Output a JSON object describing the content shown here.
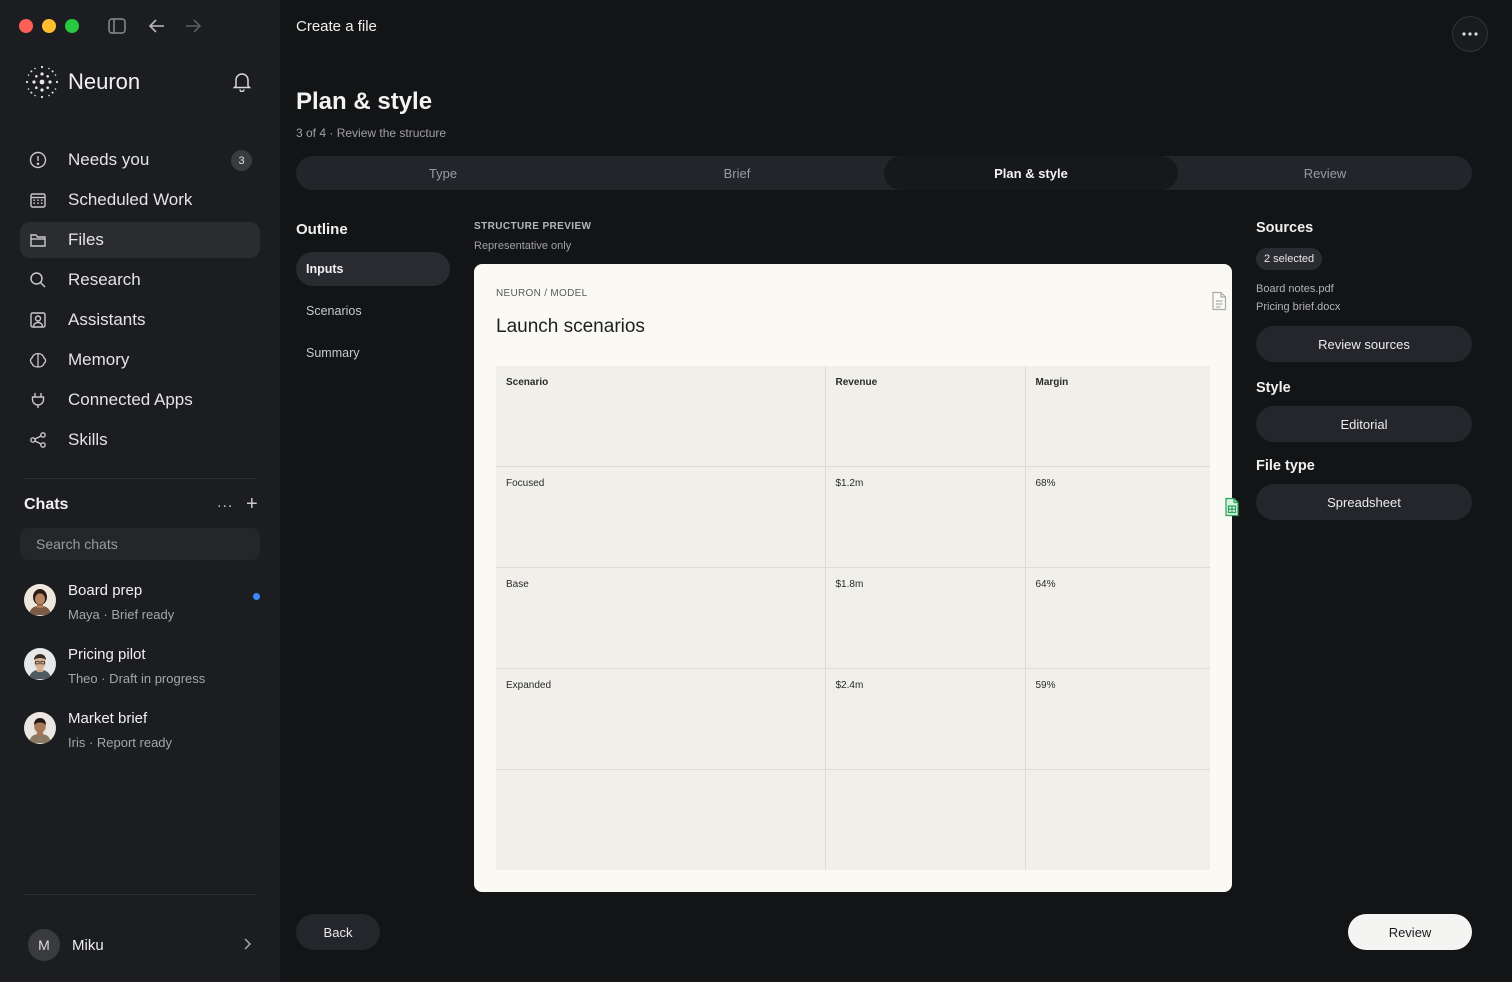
{
  "colors": {
    "close": "#ff5f57",
    "minimize": "#febc2e",
    "maximize": "#28c840",
    "unread": "#3b8bff",
    "sheet": "#2aa05a"
  },
  "app": {
    "name": "Neuron"
  },
  "nav": [
    {
      "label": "Needs you",
      "icon": "alert-circle-icon",
      "badge": "3"
    },
    {
      "label": "Scheduled Work",
      "icon": "calendar-icon"
    },
    {
      "label": "Files",
      "icon": "folder-icon",
      "active": true
    },
    {
      "label": "Research",
      "icon": "search-icon"
    },
    {
      "label": "Assistants",
      "icon": "assistant-icon"
    },
    {
      "label": "Memory",
      "icon": "brain-icon"
    },
    {
      "label": "Connected Apps",
      "icon": "plug-icon"
    },
    {
      "label": "Skills",
      "icon": "share-nodes-icon"
    }
  ],
  "chats": {
    "title": "Chats",
    "more": "...",
    "add": "+",
    "search_placeholder": "Search chats",
    "items": [
      {
        "title": "Board prep",
        "subtitle": "Maya · Brief ready",
        "unread": true
      },
      {
        "title": "Pricing pilot",
        "subtitle": "Theo · Draft in progress"
      },
      {
        "title": "Market brief",
        "subtitle": "Iris · Report ready"
      }
    ]
  },
  "user": {
    "initial": "M",
    "name": "Miku"
  },
  "page": {
    "header": "Create a file",
    "title": "Plan & style",
    "step": "3 of 4 · Review the structure"
  },
  "tabs": [
    {
      "label": "Type"
    },
    {
      "label": "Brief"
    },
    {
      "label": "Plan & style",
      "active": true
    },
    {
      "label": "Review"
    }
  ],
  "outline": {
    "title": "Outline",
    "items": [
      "Inputs",
      "Scenarios",
      "Summary"
    ],
    "active": 0
  },
  "preview": {
    "label": "STRUCTURE PREVIEW",
    "sublabel": "Representative only",
    "crumb": "NEURON / MODEL",
    "title": "Launch scenarios",
    "table": {
      "headers": [
        "Scenario",
        "Revenue",
        "Margin"
      ],
      "rows": [
        [
          "Focused",
          "$1.2m",
          "68%"
        ],
        [
          "Base",
          "$1.8m",
          "64%"
        ],
        [
          "Expanded",
          "$2.4m",
          "59%"
        ],
        [
          "",
          "",
          ""
        ]
      ]
    }
  },
  "sources": {
    "title": "Sources",
    "chip": "2 selected",
    "files": [
      "Board notes.pdf",
      "Pricing brief.docx"
    ],
    "button": "Review sources"
  },
  "style": {
    "title": "Style",
    "value": "Editorial"
  },
  "filetype": {
    "title": "File type",
    "value": "Spreadsheet"
  },
  "actions": {
    "back": "Back",
    "review": "Review"
  }
}
